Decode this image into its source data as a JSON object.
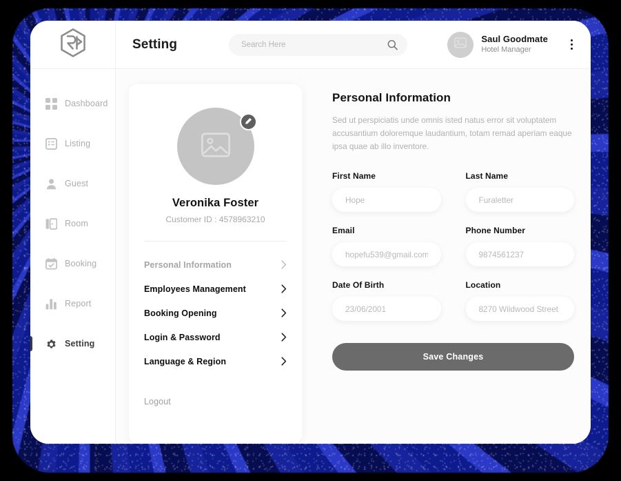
{
  "window": {
    "title": "Setting"
  },
  "brand": {
    "logo_icon": "hexagon-monogram-logo"
  },
  "sidebar": {
    "items": [
      {
        "label": "Dashboard",
        "icon": "grid-icon",
        "active": false
      },
      {
        "label": "Listing",
        "icon": "list-box-icon",
        "active": false
      },
      {
        "label": "Guest",
        "icon": "user-icon",
        "active": false
      },
      {
        "label": "Room",
        "icon": "door-icon",
        "active": false
      },
      {
        "label": "Booking",
        "icon": "calendar-check-icon",
        "active": false
      },
      {
        "label": "Report",
        "icon": "bar-chart-icon",
        "active": false
      },
      {
        "label": "Setting",
        "icon": "gear-icon",
        "active": true
      }
    ]
  },
  "topbar": {
    "page_title": "Setting",
    "search": {
      "placeholder": "Search Here",
      "value": "",
      "icon": "search-icon"
    },
    "user": {
      "name": "Saul Goodmate",
      "role": "Hotel Manager",
      "avatar_icon": "image-placeholder-icon"
    },
    "menu_icon": "kebab-menu-icon"
  },
  "profile_card": {
    "avatar_icon": "image-placeholder-icon",
    "edit_icon": "pencil-icon",
    "name": "Veronika Foster",
    "customer_id": "Customer ID : 4578963210",
    "menu": [
      {
        "label": "Personal Information",
        "muted": true
      },
      {
        "label": "Employees Management",
        "muted": false
      },
      {
        "label": "Booking Opening",
        "muted": false
      },
      {
        "label": "Login & Password",
        "muted": false
      },
      {
        "label": "Language & Region",
        "muted": false
      }
    ],
    "chevron_icon": "chevron-right-icon",
    "logout_label": "Logout"
  },
  "personal_information": {
    "title": "Personal Information",
    "description": "Sed ut perspiciatis unde omnis isted natus error sit voluptatem accusantium doloremque laudantium, totam remad aperiam eaque ipsa quae ab illo inventore.",
    "fields": [
      {
        "label": "First Name",
        "placeholder": "Hope",
        "value": ""
      },
      {
        "label": "Last Name",
        "placeholder": "Furaletter",
        "value": ""
      },
      {
        "label": "Email",
        "placeholder": "hopefu539@gmail.com",
        "value": ""
      },
      {
        "label": "Phone Number",
        "placeholder": "9874561237",
        "value": ""
      },
      {
        "label": "Date Of Birth",
        "placeholder": "23/06/2001",
        "value": ""
      },
      {
        "label": "Location",
        "placeholder": "8270 Wildwood Street",
        "value": ""
      }
    ],
    "save_label": "Save Changes"
  },
  "colors": {
    "accent_dark": "#3c3c3c",
    "save_button": "#6b6b6b",
    "muted_text": "#a9a9a9",
    "glow": "#101c8c"
  }
}
